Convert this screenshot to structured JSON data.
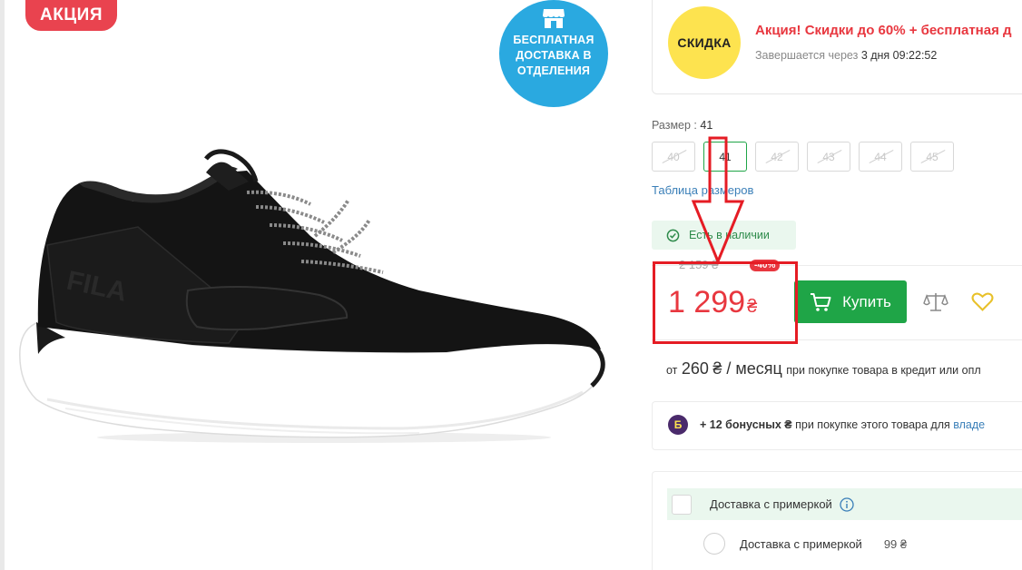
{
  "promo_badge": "АКЦИЯ",
  "delivery_badge": {
    "line1": "БЕСПЛАТНАЯ",
    "line2": "ДОСТАВКА В",
    "line3": "ОТДЕЛЕНИЯ",
    "icon": "shop-icon"
  },
  "product_image": {
    "brand_text": "FILA"
  },
  "sale": {
    "badge": "СКИДКА",
    "title": "Акция! Скидки до 60% + бесплатная д",
    "ends_label": "Завершается через",
    "ends_value": "3 дня 09:22:52"
  },
  "size": {
    "label": "Размер :",
    "selected": "41",
    "options": [
      {
        "value": "40",
        "available": false
      },
      {
        "value": "41",
        "available": true,
        "selected": true
      },
      {
        "value": "42",
        "available": false
      },
      {
        "value": "43",
        "available": false
      },
      {
        "value": "44",
        "available": false
      },
      {
        "value": "45",
        "available": false
      }
    ],
    "table_link": "Таблица размеров"
  },
  "stock": {
    "text": "Есть в наличии",
    "icon": "check-circle-icon"
  },
  "price": {
    "old": "2 159 ₴",
    "discount": "-40%",
    "current": "1 299",
    "currency": "₴"
  },
  "buy_button": "Купить",
  "credit": {
    "prefix": "от",
    "amount": "260",
    "unit": "₴ / месяц",
    "suffix": "при покупке товара в кредит или опл"
  },
  "bonus": {
    "icon_letter": "Б",
    "amount": "+ 12 бонусных ₴",
    "text": "при покупке этого товара для",
    "link": "владе"
  },
  "delivery": {
    "option_label": "Доставка с примеркой",
    "sub_label": "Доставка с примеркой",
    "sub_price": "99 ₴"
  },
  "colors": {
    "accent_green": "#1fa547",
    "sale_red": "#e8373f",
    "annotation_red": "#e51c24",
    "delivery_blue": "#2aa9e0",
    "sale_yellow": "#fde34f"
  }
}
